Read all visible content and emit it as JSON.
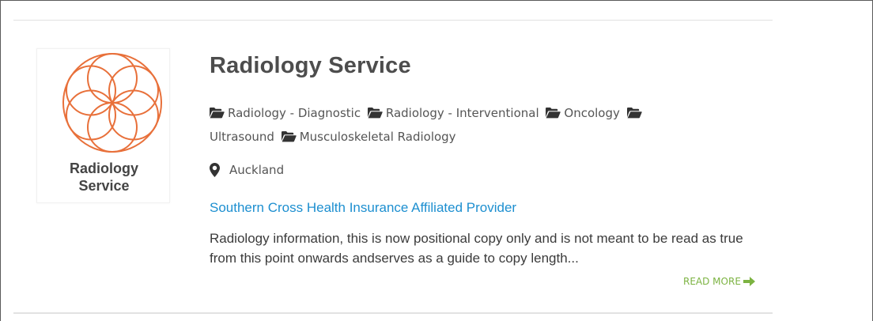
{
  "listing": {
    "logo": {
      "line1": "Radiology",
      "line2": "Service",
      "accent_color": "#e8703a",
      "icon": "flower-of-life-icon"
    },
    "title": "Radiology Service",
    "categories": [
      {
        "label": "Radiology - Diagnostic",
        "icon": "folder-icon"
      },
      {
        "label": "Radiology - Interventional",
        "icon": "folder-icon"
      },
      {
        "label": "Oncology",
        "icon": "folder-icon"
      },
      {
        "label": "Ultrasound",
        "icon": "folder-icon"
      },
      {
        "label": "Musculoskeletal Radiology",
        "icon": "folder-icon"
      }
    ],
    "location": {
      "label": "Auckland",
      "icon": "map-pin-icon"
    },
    "affiliate_link": "Southern Cross Health Insurance Affiliated Provider",
    "description": "Radiology information, this is now positional copy only and is not meant to be read as true from this point onwards andserves as a guide to copy length...",
    "read_more": {
      "label": "READ MORE",
      "icon": "arrow-right-icon",
      "color": "#7cb342"
    },
    "link_color": "#1d8fd0"
  }
}
